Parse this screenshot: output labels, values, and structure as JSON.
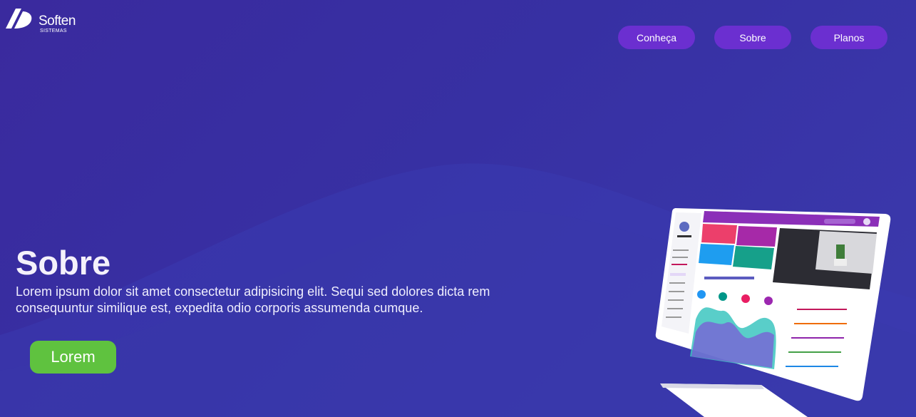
{
  "brand": {
    "name": "Soften",
    "subtitle": "SISTEMAS"
  },
  "nav": {
    "items": [
      {
        "label": "Conheça"
      },
      {
        "label": "Sobre"
      },
      {
        "label": "Planos"
      }
    ]
  },
  "hero": {
    "title": "Sobre",
    "text": "Lorem ipsum dolor sit amet consectetur adipisicing elit. Sequi sed dolores dicta rem consequuntur similique est, expedita odio corporis assumenda cumque.",
    "cta_label": "Lorem"
  },
  "colors": {
    "nav_button": "#6b2fd0",
    "cta": "#5fc23f",
    "background": "#3730a3"
  },
  "illustration": {
    "name": "dashboard-monitor-illustration"
  }
}
